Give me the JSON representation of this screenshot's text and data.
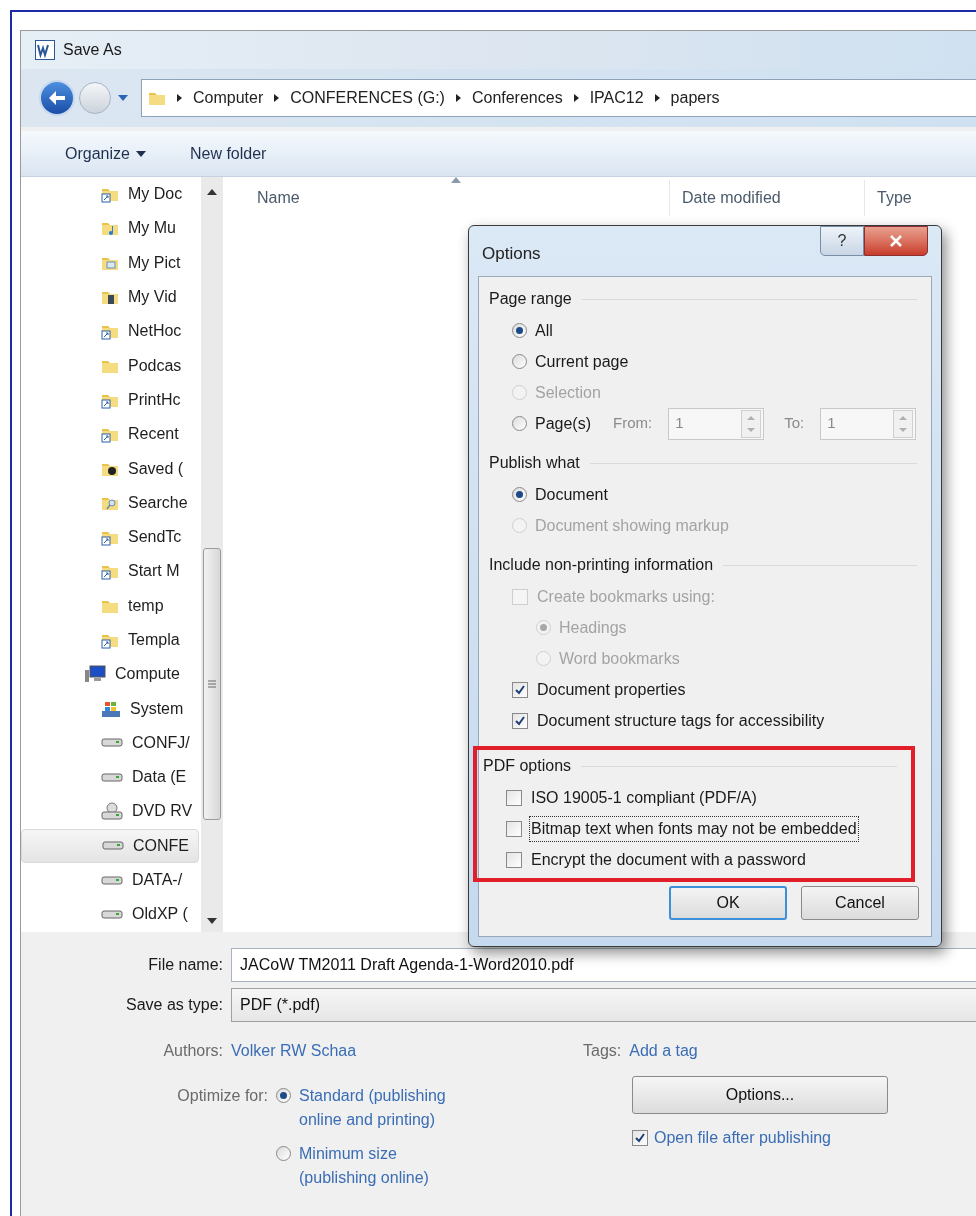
{
  "window": {
    "title": "Save As"
  },
  "address": {
    "crumbs": [
      "Computer",
      "CONFERENCES (G:)",
      "Conferences",
      "IPAC12",
      "papers"
    ]
  },
  "toolbar": {
    "organize": "Organize",
    "new_folder": "New folder"
  },
  "columns": [
    "Name",
    "Date modified",
    "Type"
  ],
  "tree": [
    {
      "children": [
        {
          "label": "My Doc",
          "kind": "shortcut",
          "selected": false
        },
        {
          "label": "My Mu",
          "kind": "music",
          "selected": false
        },
        {
          "label": "My Pict",
          "kind": "pictures",
          "selected": false
        },
        {
          "label": "My Vid",
          "kind": "video",
          "selected": false
        },
        {
          "label": "NetHoc",
          "kind": "shortcut",
          "selected": false
        },
        {
          "label": "Podcas",
          "kind": "folder",
          "selected": false
        },
        {
          "label": "PrintHc",
          "kind": "shortcut",
          "selected": false
        },
        {
          "label": "Recent",
          "kind": "shortcut",
          "selected": false
        },
        {
          "label": "Saved (",
          "kind": "saved",
          "selected": false
        },
        {
          "label": "Searche",
          "kind": "search",
          "selected": false
        },
        {
          "label": "SendTc",
          "kind": "shortcut",
          "selected": false
        },
        {
          "label": "Start M",
          "kind": "shortcut",
          "selected": false
        },
        {
          "label": "temp",
          "kind": "folder",
          "selected": false
        },
        {
          "label": "Templa",
          "kind": "shortcut",
          "selected": false
        }
      ]
    },
    {
      "label": "Compute",
      "kind": "computer",
      "selected": false,
      "children": [
        {
          "label": "System",
          "kind": "system",
          "selected": false
        },
        {
          "label": "CONFJ/",
          "kind": "drive",
          "selected": false
        },
        {
          "label": "Data (E",
          "kind": "drive",
          "selected": false
        },
        {
          "label": "DVD RV",
          "kind": "dvd",
          "selected": false
        },
        {
          "label": "CONFE",
          "kind": "drive",
          "selected": true
        },
        {
          "label": "DATA-/",
          "kind": "drive",
          "selected": false
        },
        {
          "label": "OldXP (",
          "kind": "drive",
          "selected": false
        }
      ]
    }
  ],
  "options_dialog": {
    "title": "Options",
    "help": "?",
    "sections": [
      {
        "title": "Page range",
        "highlighted": false,
        "rows": [
          {
            "kind": "radio",
            "label": "All",
            "checked": true,
            "disabled": false
          },
          {
            "kind": "radio",
            "label": "Current page",
            "checked": false,
            "disabled": false
          },
          {
            "kind": "radio",
            "label": "Selection",
            "checked": false,
            "disabled": true
          },
          {
            "kind": "pages",
            "label": "Page(s)",
            "checked": false,
            "disabled": false,
            "from_label": "From:",
            "from": "1",
            "to_label": "To:",
            "to": "1"
          }
        ]
      },
      {
        "title": "Publish what",
        "highlighted": false,
        "rows": [
          {
            "kind": "radio",
            "label": "Document",
            "checked": true,
            "disabled": false
          },
          {
            "kind": "radio",
            "label": "Document showing markup",
            "checked": false,
            "disabled": true
          }
        ]
      },
      {
        "title": "Include non-printing information",
        "highlighted": false,
        "rows": [
          {
            "kind": "checkbox",
            "label": "Create bookmarks using:",
            "checked": false,
            "disabled": true,
            "children": [
              {
                "kind": "radio",
                "label": "Headings",
                "checked": true,
                "disabled": true
              },
              {
                "kind": "radio",
                "label": "Word bookmarks",
                "checked": false,
                "disabled": true
              }
            ]
          },
          {
            "kind": "checkbox",
            "label": "Document properties",
            "checked": true,
            "disabled": false
          },
          {
            "kind": "checkbox",
            "label": "Document structure tags for accessibility",
            "checked": true,
            "disabled": false
          }
        ]
      },
      {
        "title": "PDF options",
        "highlighted": true,
        "rows": [
          {
            "kind": "checkbox",
            "label": "ISO 19005-1 compliant (PDF/A)",
            "checked": false,
            "disabled": false,
            "focused": false
          },
          {
            "kind": "checkbox",
            "label": "Bitmap text when fonts may not be embedded",
            "checked": false,
            "disabled": false,
            "focused": true
          },
          {
            "kind": "checkbox",
            "label": "Encrypt the document with a password",
            "checked": false,
            "disabled": false,
            "focused": false
          }
        ]
      }
    ],
    "buttons": [
      {
        "label": "OK",
        "default": true
      },
      {
        "label": "Cancel",
        "default": false
      }
    ]
  },
  "form": {
    "file_name": {
      "label": "File name:",
      "value": "JACoW TM2011 Draft Agenda-1-Word2010.pdf"
    },
    "save_type": {
      "label": "Save as type:",
      "value": "PDF (*.pdf)"
    },
    "authors": {
      "label": "Authors:",
      "value": "Volker RW Schaa"
    },
    "tags": {
      "label": "Tags:",
      "value": "Add a tag"
    },
    "optimize": {
      "label": "Optimize for:",
      "options": [
        {
          "label": "Standard (publishing online and printing)",
          "checked": true
        },
        {
          "label": "Minimum size (publishing online)",
          "checked": false
        }
      ]
    },
    "options_button": "Options...",
    "open_after": {
      "label": "Open file after publishing",
      "checked": true
    }
  }
}
